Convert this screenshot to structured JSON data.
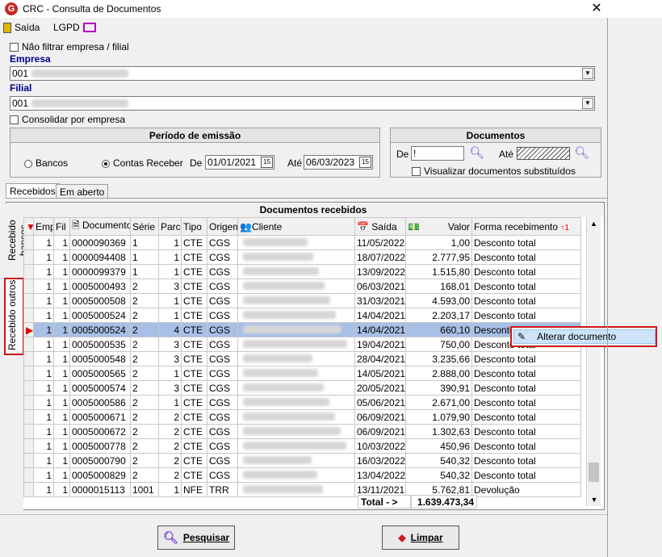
{
  "window": {
    "title": "CRC - Consulta de Documentos",
    "close_glyph": "✕"
  },
  "toolbar": {
    "saida": "Saída",
    "lgpd": "LGPD"
  },
  "filters": {
    "nao_filtrar": "Não filtrar empresa / filial",
    "empresa_label": "Empresa",
    "empresa_value": "001",
    "filial_label": "Filial",
    "filial_value": "001",
    "consolidar": "Consolidar por empresa"
  },
  "periodo": {
    "title": "Período de emissão",
    "bancos": "Bancos",
    "contas_receber": "Contas Receber",
    "de_label": "De",
    "de_value": "01/01/2021",
    "ate_label": "Até",
    "ate_value": "06/03/2023"
  },
  "documentos": {
    "title": "Documentos",
    "de_label": "De",
    "de_value": "!",
    "ate_label": "Até",
    "visualizar": "Visualizar documentos substituídos"
  },
  "tabs": [
    "Recebidos",
    "Em aberto"
  ],
  "side_tabs": [
    "Recebido bancos",
    "Recebido outros"
  ],
  "grid": {
    "title": "Documentos  recebidos",
    "columns": [
      "Emp",
      "Fil",
      "Documento",
      "Série",
      "Parc",
      "Tipo",
      "Origem",
      "Cliente",
      "Saída",
      "Valor",
      "Forma recebimento"
    ],
    "rows": [
      [
        "1",
        "1",
        "0000090369",
        "1",
        "1",
        "CTE",
        "CGS",
        "11/05/2022",
        "1,00",
        "Desconto total"
      ],
      [
        "1",
        "1",
        "0000094408",
        "1",
        "1",
        "CTE",
        "CGS",
        "18/07/2022",
        "2.777,95",
        "Desconto total"
      ],
      [
        "1",
        "1",
        "0000099379",
        "1",
        "1",
        "CTE",
        "CGS",
        "13/09/2022",
        "1.515,80",
        "Desconto total"
      ],
      [
        "1",
        "1",
        "0005000493",
        "2",
        "3",
        "CTE",
        "CGS",
        "06/03/2021",
        "168,01",
        "Desconto total"
      ],
      [
        "1",
        "1",
        "0005000508",
        "2",
        "1",
        "CTE",
        "CGS",
        "31/03/2021",
        "4.593,00",
        "Desconto total"
      ],
      [
        "1",
        "1",
        "0005000524",
        "2",
        "1",
        "CTE",
        "CGS",
        "14/04/2021",
        "2.203,17",
        "Desconto total"
      ],
      [
        "1",
        "1",
        "0005000524",
        "2",
        "4",
        "CTE",
        "CGS",
        "14/04/2021",
        "660,10",
        "Desconto"
      ],
      [
        "1",
        "1",
        "0005000535",
        "2",
        "3",
        "CTE",
        "CGS",
        "19/04/2021",
        "750,00",
        "Desconto total"
      ],
      [
        "1",
        "1",
        "0005000548",
        "2",
        "3",
        "CTE",
        "CGS",
        "28/04/2021",
        "3.235,66",
        "Desconto total"
      ],
      [
        "1",
        "1",
        "0005000565",
        "2",
        "1",
        "CTE",
        "CGS",
        "14/05/2021",
        "2.888,00",
        "Desconto total"
      ],
      [
        "1",
        "1",
        "0005000574",
        "2",
        "3",
        "CTE",
        "CGS",
        "20/05/2021",
        "390,91",
        "Desconto total"
      ],
      [
        "1",
        "1",
        "0005000586",
        "2",
        "1",
        "CTE",
        "CGS",
        "05/06/2021",
        "2.671,00",
        "Desconto total"
      ],
      [
        "1",
        "1",
        "0005000671",
        "2",
        "2",
        "CTE",
        "CGS",
        "06/09/2021",
        "1.079,90",
        "Desconto total"
      ],
      [
        "1",
        "1",
        "0005000672",
        "2",
        "2",
        "CTE",
        "CGS",
        "06/09/2021",
        "1.302,63",
        "Desconto total"
      ],
      [
        "1",
        "1",
        "0005000778",
        "2",
        "2",
        "CTE",
        "CGS",
        "10/03/2022",
        "450,96",
        "Desconto total"
      ],
      [
        "1",
        "1",
        "0005000790",
        "2",
        "2",
        "CTE",
        "CGS",
        "16/03/2022",
        "540,32",
        "Desconto total"
      ],
      [
        "1",
        "1",
        "0005000829",
        "2",
        "2",
        "CTE",
        "CGS",
        "13/04/2022",
        "540,32",
        "Desconto total"
      ],
      [
        "1",
        "1",
        "0000015113",
        "1001",
        "1",
        "NFE",
        "TRR",
        "13/11/2021",
        "5.762,81",
        "Devolução"
      ]
    ],
    "selected_row": 6,
    "total_label": "Total - >",
    "total_value": "1.639.473,34"
  },
  "context_menu": {
    "item": "Alterar documento"
  },
  "buttons": {
    "pesquisar": "Pesquisar",
    "limpar": "Limpar"
  },
  "colors": {
    "highlight": "#d01818",
    "selected_row": "#a8bfe6",
    "label_blue": "#00008b"
  }
}
